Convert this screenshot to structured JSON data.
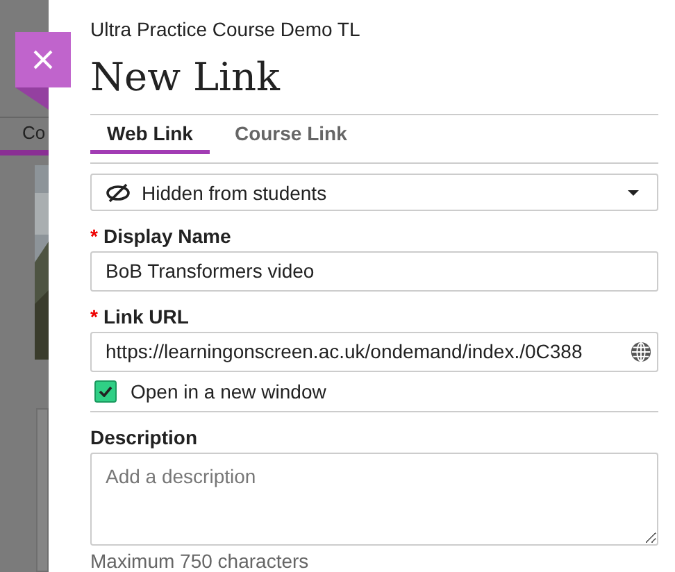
{
  "background": {
    "tab_label": "Co"
  },
  "panel": {
    "course": "Ultra Practice Course Demo TL",
    "title": "New Link"
  },
  "tabs": [
    {
      "label": "Web Link",
      "selected": true
    },
    {
      "label": "Course Link",
      "selected": false
    }
  ],
  "visibility": {
    "value": "Hidden from students"
  },
  "fields": [
    {
      "kind": "input",
      "label": "Display Name",
      "required_mark": "*",
      "value": "BoB Transformers video"
    },
    {
      "kind": "url",
      "label": "Link URL",
      "required_mark": "*",
      "value": "https://learningonscreen.ac.uk/ondemand/index./0C388"
    }
  ],
  "open_new_window": {
    "label": "Open in a new window",
    "checked": true
  },
  "description": {
    "label": "Description",
    "placeholder": "Add a description",
    "hint": "Maximum 750 characters"
  }
}
